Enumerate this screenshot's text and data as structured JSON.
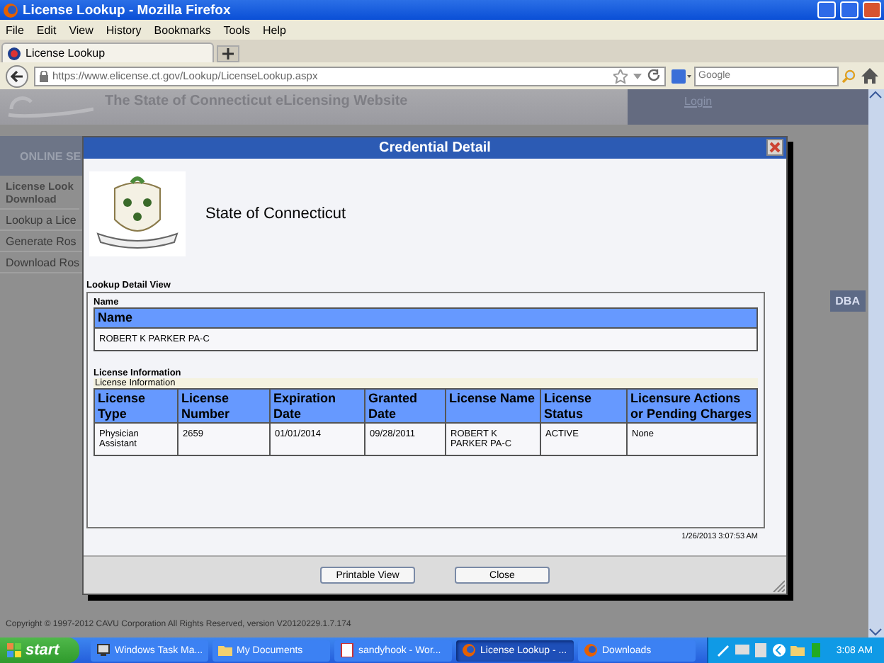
{
  "window": {
    "title": "License Lookup - Mozilla Firefox"
  },
  "menu": [
    "File",
    "Edit",
    "View",
    "History",
    "Bookmarks",
    "Tools",
    "Help"
  ],
  "tabs": [
    {
      "label": "License Lookup",
      "selected": true
    }
  ],
  "address_bar": {
    "url": "https://www.elicense.ct.gov/Lookup/LicenseLookup.aspx"
  },
  "search": {
    "placeholder": "Google"
  },
  "background_page": {
    "site_title": "The State of Connecticut eLicensing Website",
    "login": "Login",
    "sidebar_heading": "ONLINE SE",
    "sidebar_items": [
      {
        "label": "License Look Download",
        "selected": true
      },
      {
        "label": "Lookup a Lice",
        "selected": false
      },
      {
        "label": "Generate Ros",
        "selected": false
      },
      {
        "label": "Download Ros",
        "selected": false
      }
    ],
    "table_header": "DBA",
    "copyright": "Copyright © 1997-2012 CAVU Corporation All Rights Reserved, version V20120229.1.7.174"
  },
  "dialog": {
    "title": "Credential Detail",
    "organization": "State of Connecticut",
    "section": "Lookup Detail View",
    "name_group": {
      "label": "Name",
      "header": "Name",
      "value": "ROBERT K PARKER PA-C"
    },
    "license_group": {
      "label": "License Information",
      "caption": "License Information",
      "columns": [
        "License Type",
        "License Number",
        "Expiration Date",
        "Granted Date",
        "License Name",
        "License Status",
        "Licensure Actions or Pending Charges"
      ],
      "rows": [
        [
          "Physician Assistant",
          "2659",
          "01/01/2014",
          "09/28/2011",
          "ROBERT K PARKER PA-C",
          "ACTIVE",
          "None"
        ]
      ]
    },
    "timestamp": "1/26/2013 3:07:53 AM",
    "buttons": [
      "Printable View",
      "Close"
    ]
  },
  "taskbar": {
    "start": "start",
    "items": [
      {
        "label": "Windows Task Ma...",
        "selected": false
      },
      {
        "label": "My Documents",
        "selected": false
      },
      {
        "label": "sandyhook - Wor...",
        "selected": false
      },
      {
        "label": "License Lookup - ...",
        "selected": true
      },
      {
        "label": "Downloads",
        "selected": false
      }
    ],
    "clock": "3:08 AM"
  }
}
